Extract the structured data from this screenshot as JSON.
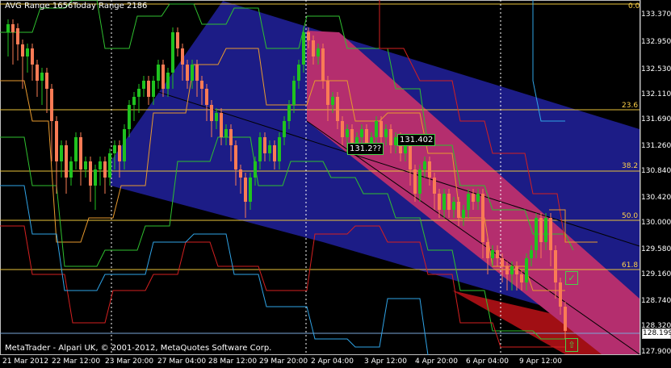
{
  "header": {
    "avg_range": "AVG Range 1656",
    "today_range": "Today Range 2186"
  },
  "price_axis": {
    "labels": [
      "133.370",
      "132.950",
      "132.530",
      "132.110",
      "131.690",
      "131.260",
      "130.840",
      "130.420",
      "130.000",
      "129.580",
      "129.160",
      "128.740",
      "128.320",
      "127.900"
    ],
    "current_price": "128.199"
  },
  "time_axis": {
    "labels": [
      "21 Mar 2012",
      "22 Mar 12:00",
      "23 Mar 20:00",
      "27 Mar 04:00",
      "28 Mar 12:00",
      "29 Mar 20:00",
      "2 Apr 04:00",
      "3 Apr 12:00",
      "4 Apr 20:00",
      "6 Apr 04:00",
      "9 Apr 12:00"
    ]
  },
  "fibo_levels": [
    "0.0",
    "23.6",
    "38.2",
    "50.0",
    "61.8"
  ],
  "price_boxes": [
    "131.2??",
    "131.402"
  ],
  "copyright": "MetaTrader - Alpari UK, © 2001-2012, MetaQuotes Software Corp.",
  "markers": {
    "check_icon": "check-icon",
    "arrow_icon": "arrow-up-icon"
  },
  "colors": {
    "background": "#000000",
    "channel_outer": "#1c1c86",
    "channel_inner": "#b42e6e",
    "channel_lower": "#a10f14",
    "bull": "#1fc21f",
    "bear": "#f97b55",
    "fib_line": "#e8c23a",
    "envelope_green": "#2fc02f",
    "envelope_red": "#d42020",
    "envelope_orange": "#e89a2e",
    "envelope_blue": "#2fa3e6"
  }
}
